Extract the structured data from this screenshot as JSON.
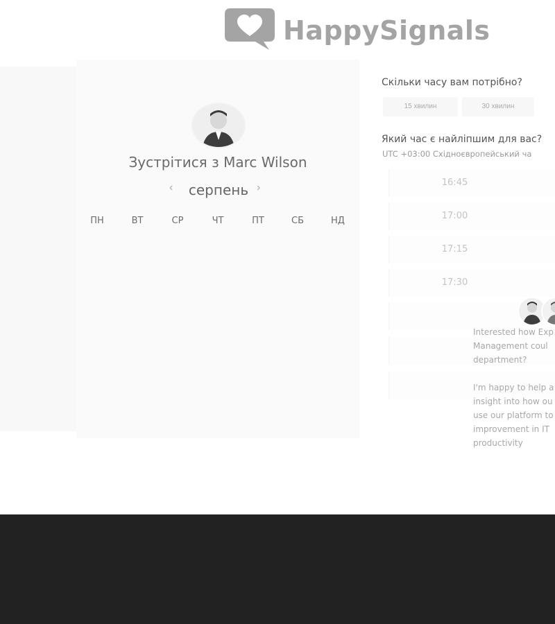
{
  "brand": {
    "name": "HappySignals",
    "logo_color": "#a4a4a4"
  },
  "calendar": {
    "title": "Зустрітися з Marc Wilson",
    "month": "серпень",
    "prev_icon": "‹",
    "next_icon": "›",
    "weekdays": [
      "ПН",
      "ВТ",
      "СР",
      "ЧТ",
      "ПТ",
      "СБ",
      "НД"
    ]
  },
  "duration": {
    "question": "Скільки часу вам потрібно?",
    "options": [
      "15 хвилин",
      "30 хвилин"
    ]
  },
  "time": {
    "question": "Який час є найліпшим для вас?",
    "timezone": "UTC +03:00 Східноєвропейський ча",
    "slots": [
      "16:45",
      "17:00",
      "17:15",
      "17:30"
    ]
  },
  "chat": {
    "lines": [
      "Interested how Exp",
      "Management coul",
      "department?",
      "I'm happy to help a",
      "insight into how ou",
      "use our platform to",
      "improvement in IT",
      "productivity"
    ]
  },
  "colors": {
    "footer": "#222222",
    "panel": "#fafafa",
    "strip": "#f8f8f8"
  }
}
